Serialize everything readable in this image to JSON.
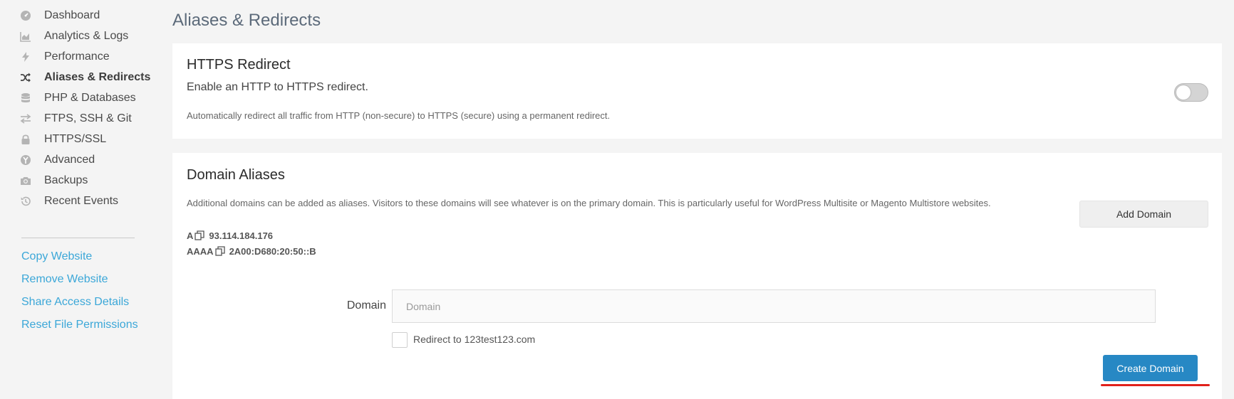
{
  "sidebar": {
    "items": [
      {
        "label": "Dashboard",
        "icon": "dashboard-icon"
      },
      {
        "label": "Analytics & Logs",
        "icon": "chart-icon"
      },
      {
        "label": "Performance",
        "icon": "bolt-icon"
      },
      {
        "label": "Aliases & Redirects",
        "icon": "shuffle-icon",
        "active": true
      },
      {
        "label": "PHP & Databases",
        "icon": "database-icon"
      },
      {
        "label": "FTPS, SSH & Git",
        "icon": "exchange-icon"
      },
      {
        "label": "HTTPS/SSL",
        "icon": "lock-icon"
      },
      {
        "label": "Advanced",
        "icon": "tools-icon"
      },
      {
        "label": "Backups",
        "icon": "camera-icon"
      },
      {
        "label": "Recent Events",
        "icon": "history-icon"
      }
    ],
    "links": [
      {
        "label": "Copy Website"
      },
      {
        "label": "Remove Website"
      },
      {
        "label": "Share Access Details"
      },
      {
        "label": "Reset File Permissions"
      }
    ]
  },
  "page": {
    "title": "Aliases & Redirects"
  },
  "https_redirect": {
    "title": "HTTPS Redirect",
    "subtitle": "Enable an HTTP to HTTPS redirect.",
    "description": "Automatically redirect all traffic from HTTP (non-secure) to HTTPS (secure) using a permanent redirect.",
    "enabled": false
  },
  "domain_aliases": {
    "title": "Domain Aliases",
    "description": "Additional domains can be added as aliases. Visitors to these domains will see whatever is on the primary domain. This is particularly useful for WordPress Multisite or Magento Multistore websites.",
    "add_button": "Add Domain",
    "dns_records": [
      {
        "type": "A",
        "value": "93.114.184.176"
      },
      {
        "type": "AAAA",
        "value": "2A00:D680:20:50::B"
      }
    ],
    "form": {
      "domain_label": "Domain",
      "domain_placeholder": "Domain",
      "domain_value": "",
      "redirect_label": "Redirect to 123test123.com",
      "redirect_checked": false,
      "submit_label": "Create Domain"
    }
  },
  "colors": {
    "accent_blue": "#2788c4",
    "link_blue": "#3ba7d8",
    "annotation_red": "#e0211b"
  }
}
